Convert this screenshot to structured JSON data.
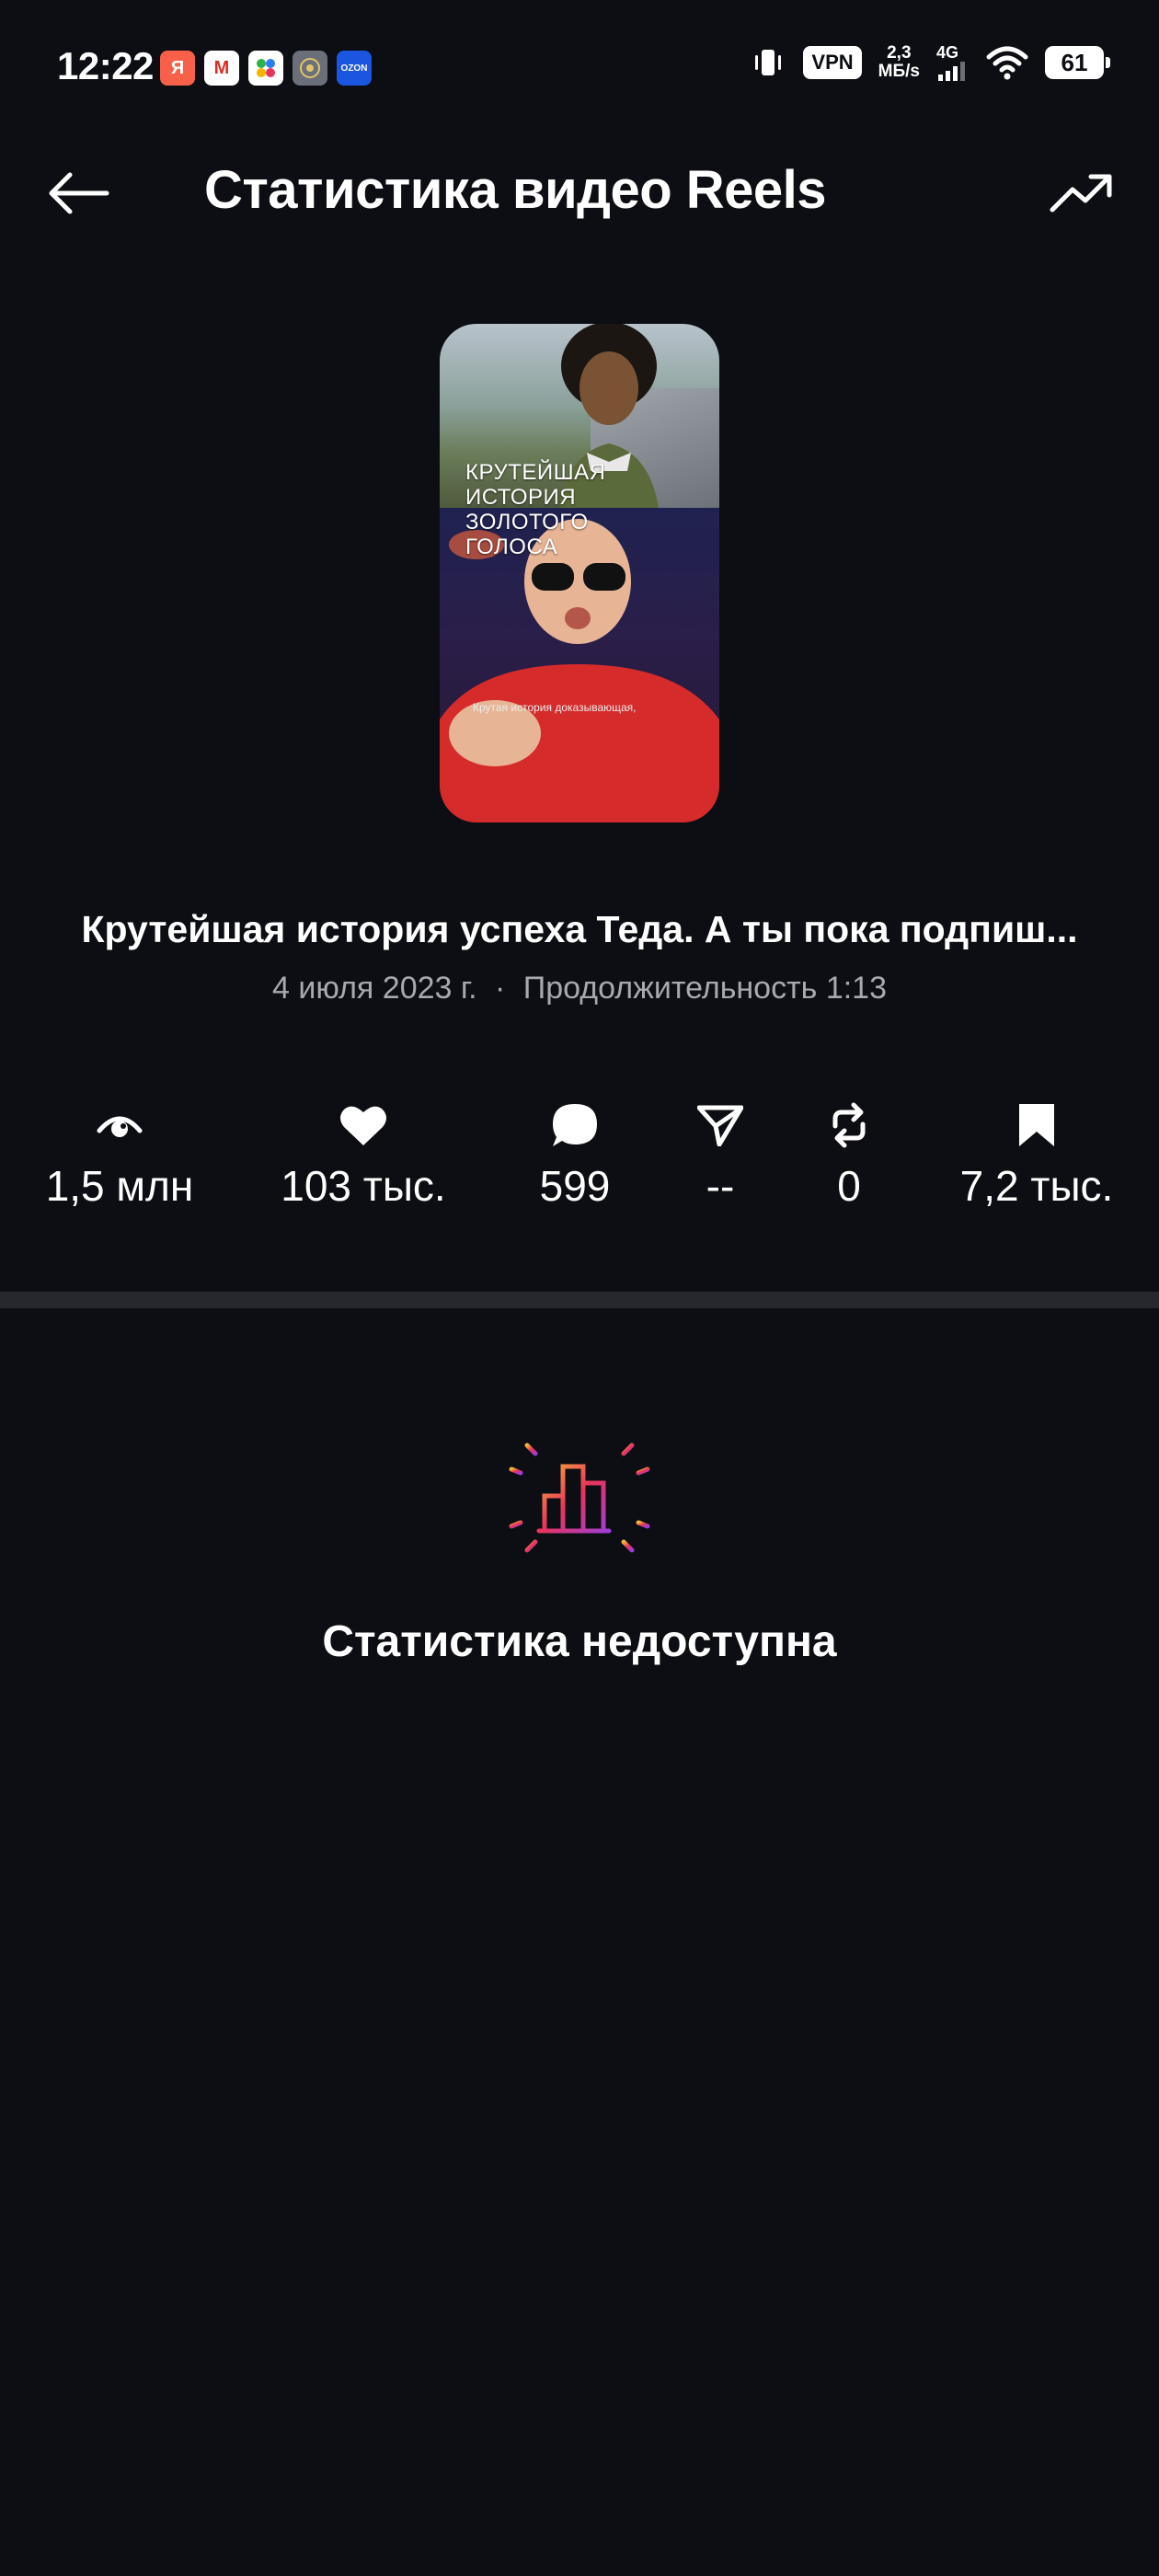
{
  "status_bar": {
    "time": "12:22",
    "app_icons": [
      "yandex-icon",
      "gmail-icon",
      "dots-app-icon",
      "gosuslugi-icon",
      "ozon-icon"
    ],
    "ozon_label": "OZON",
    "ya_label": "Я",
    "gmail_label": "M",
    "vpn": "VPN",
    "speed_value": "2,3",
    "speed_unit": "МБ/s",
    "network": "4G",
    "battery": "61"
  },
  "header": {
    "title": "Статистика видео Reels"
  },
  "reel": {
    "thumbnail_caption": "КРУТЕЙШАЯ\nИСТОРИЯ\nЗОЛОТОГО\nГОЛОСА",
    "thumbnail_subtitle": "Крутая история доказывающая,",
    "title": "Крутейшая история успеха Теда. А ты пока подпиш...",
    "date": "4 июля 2023 г.",
    "separator": "·",
    "duration": "Продолжительность 1:13"
  },
  "stats": {
    "views": "1,5 млн",
    "likes": "103 тыс.",
    "comments": "599",
    "shares": "--",
    "reposts": "0",
    "saves": "7,2 тыс."
  },
  "empty_state": {
    "title": "Статистика недоступна"
  },
  "colors": {
    "background": "#0c0e13",
    "divider": "#26282d",
    "meta_text": "#a6a9b0",
    "gradient_start": "#f5b43c",
    "gradient_mid": "#e8345a",
    "gradient_end": "#a03cd6"
  }
}
